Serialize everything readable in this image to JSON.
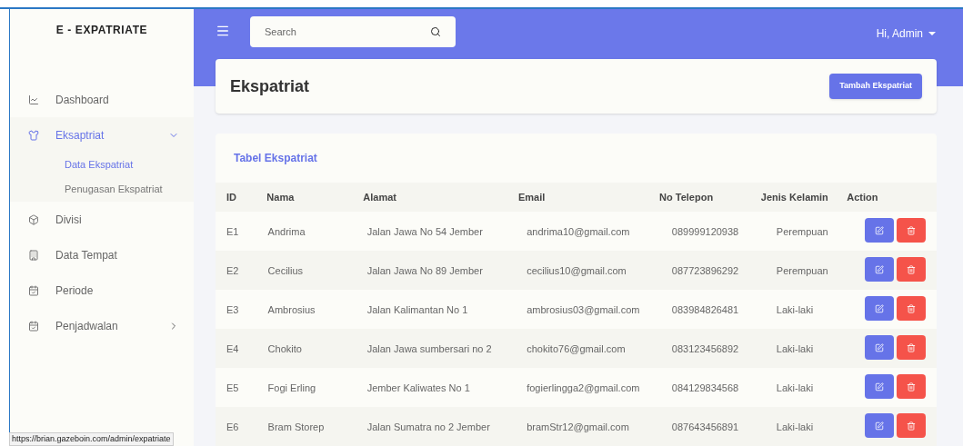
{
  "sidebar": {
    "brand": "E - EXPATRIATE",
    "items": [
      {
        "kind": "chart",
        "label": "Dashboard",
        "selected": false
      },
      {
        "kind": "person",
        "label": "Eksaptriat",
        "selected": true,
        "expanded": true,
        "children": [
          {
            "label": "Data Ekspatriat",
            "selected": true
          },
          {
            "label": "Penugasan Ekspatriat",
            "selected": false
          }
        ]
      },
      {
        "kind": "cube",
        "label": "Divisi",
        "selected": false
      },
      {
        "kind": "building",
        "label": "Data Tempat",
        "selected": false
      },
      {
        "kind": "calendar",
        "label": "Periode",
        "selected": false
      },
      {
        "kind": "calendar",
        "label": "Penjadwalan",
        "selected": false,
        "expanded": false
      }
    ]
  },
  "topbar": {
    "search": {
      "placeholder": "Search"
    },
    "user": "Hi, Admin"
  },
  "header": {
    "title": "Ekspatriat",
    "button": "Tambah Ekspatriat"
  },
  "table": {
    "title": "Tabel Ekspatriat",
    "columns": [
      "ID",
      "Nama",
      "Alamat",
      "Email",
      "No Telepon",
      "Jenis Kelamin",
      "Action"
    ],
    "rows": [
      [
        "E1",
        "Andrima",
        "Jalan Jawa No 54 Jember",
        "andrima10@gmail.com",
        "089999120938",
        "Perempuan"
      ],
      [
        "E2",
        "Cecilius",
        "Jalan Jawa No 89 Jember",
        "cecilius10@gmail.com",
        "087723896292",
        "Perempuan"
      ],
      [
        "E3",
        "Ambrosius",
        "Jalan Kalimantan No 1",
        "ambrosius03@gmail.com",
        "083984826481",
        "Laki-laki"
      ],
      [
        "E4",
        "Chokito",
        "Jalan Jawa sumbersari no 2",
        "chokito76@gmail.com",
        "083123456892",
        "Laki-laki"
      ],
      [
        "E5",
        "Fogi Erling",
        "Jember Kaliwates No 1",
        "fogierlingga2@gmail.com",
        "084129834568",
        "Laki-laki"
      ],
      [
        "E6",
        "Bram Storep",
        "Jalan Sumatra no 2 Jember",
        "bramStr12@gmail.com",
        "087643456891",
        "Laki-laki"
      ]
    ]
  },
  "status_bar": "https://brian.gazeboin.com/admin/expatriate"
}
